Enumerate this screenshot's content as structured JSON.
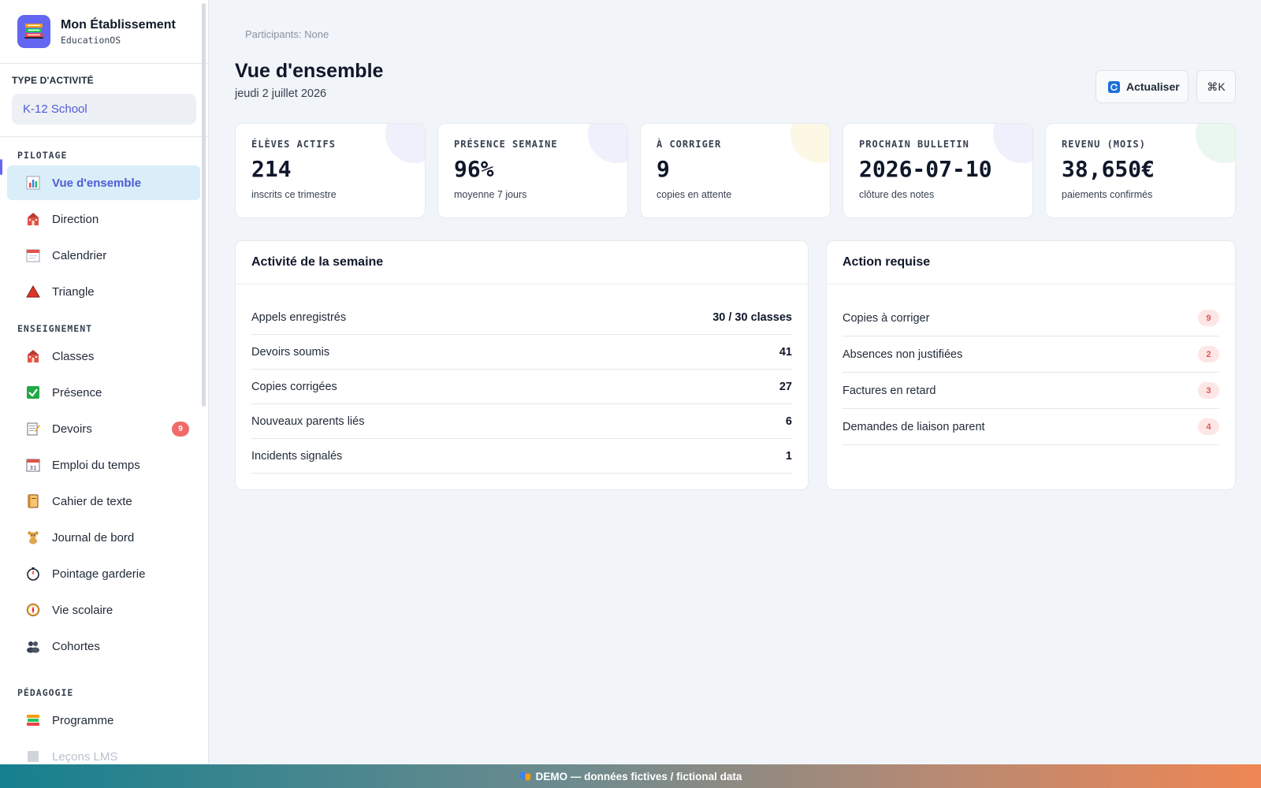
{
  "brand": {
    "title": "Mon Établissement",
    "subtitle": "EducationOS"
  },
  "activity": {
    "label": "TYPE D'ACTIVITÉ",
    "value": "K-12 School"
  },
  "nav": {
    "sections": {
      "pilotage": "PILOTAGE",
      "enseignement": "ENSEIGNEMENT",
      "pedagogie": "PÉDAGOGIE"
    },
    "items": {
      "overview": "Vue d'ensemble",
      "direction": "Direction",
      "calendar": "Calendrier",
      "triangle": "Triangle",
      "classes": "Classes",
      "presence": "Présence",
      "homework": "Devoirs",
      "homework_badge": "9",
      "timetable": "Emploi du temps",
      "textbook": "Cahier de texte",
      "logbook": "Journal de bord",
      "daycare": "Pointage garderie",
      "school_life": "Vie scolaire",
      "cohorts": "Cohortes",
      "program": "Programme",
      "lms": "Leçons LMS"
    }
  },
  "header": {
    "breadcrumb": "Participants: None",
    "title": "Vue d'ensemble",
    "date": "jeudi 2 juillet 2026",
    "refresh_label": "Actualiser",
    "shortcut_label": "⌘K"
  },
  "kpis": [
    {
      "label": "ÉLÈVES ACTIFS",
      "value": "214",
      "sub": "inscrits ce trimestre",
      "color": "#eef0fb"
    },
    {
      "label": "PRÉSENCE SEMAINE",
      "value": "96%",
      "sub": "moyenne 7 jours",
      "color": "#eef0fb"
    },
    {
      "label": "À CORRIGER",
      "value": "9",
      "sub": "copies en attente",
      "color": "#fdf8e6"
    },
    {
      "label": "PROCHAIN BULLETIN",
      "value": "2026-07-10",
      "sub": "clôture des notes",
      "color": "#eef0fb"
    },
    {
      "label": "REVENU (MOIS)",
      "value": "38,650€",
      "sub": "paiements confirmés",
      "color": "#eaf7ef"
    }
  ],
  "weekly": {
    "title": "Activité de la semaine",
    "rows": [
      {
        "label": "Appels enregistrés",
        "value": "30 / 30 classes"
      },
      {
        "label": "Devoirs soumis",
        "value": "41"
      },
      {
        "label": "Copies corrigées",
        "value": "27"
      },
      {
        "label": "Nouveaux parents liés",
        "value": "6"
      },
      {
        "label": "Incidents signalés",
        "value": "1"
      }
    ]
  },
  "actions": {
    "title": "Action requise",
    "rows": [
      {
        "label": "Copies à corriger",
        "value": "9"
      },
      {
        "label": "Absences non justifiées",
        "value": "2"
      },
      {
        "label": "Factures en retard",
        "value": "3"
      },
      {
        "label": "Demandes de liaison parent",
        "value": "4"
      }
    ]
  },
  "footer": {
    "text": "DEMO — données fictives / fictional data"
  }
}
